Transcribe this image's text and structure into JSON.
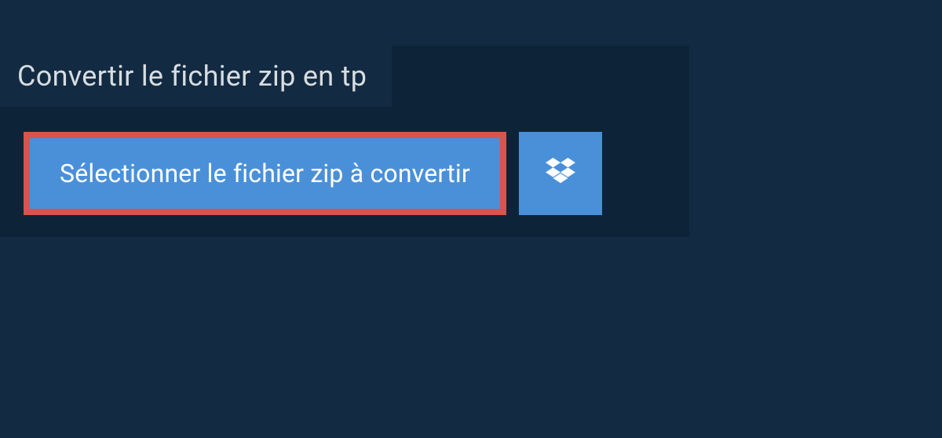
{
  "header": {
    "title": "Convertir le fichier zip en tp"
  },
  "actions": {
    "select_file_label": "Sélectionner le fichier zip à convertir",
    "dropbox_icon_name": "dropbox"
  },
  "colors": {
    "page_bg": "#122b42",
    "panel_bg": "#0d2438",
    "button_bg": "#4a90d9",
    "highlight_border": "#d9534f",
    "text_light": "#d8dde1"
  }
}
